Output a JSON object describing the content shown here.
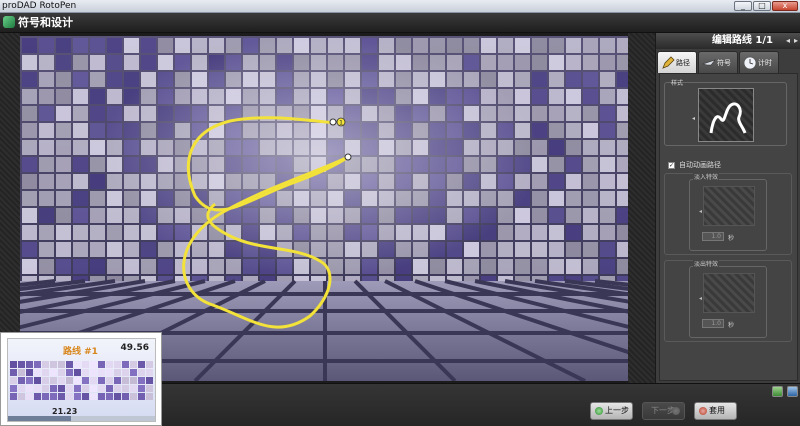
{
  "window": {
    "title": "proDAD RotoPen",
    "minimize": "_",
    "maximize": "□",
    "close": "x"
  },
  "header": {
    "title": "符号和设计"
  },
  "thumbnail": {
    "path_label": "路线 #1",
    "time_top": "49.56",
    "time_bottom": "21.23",
    "progress": 0.43
  },
  "panel": {
    "title": "编辑路线 1/1",
    "prev_arrow": "◂",
    "next_arrow": "▸",
    "tabs": [
      {
        "label": "路径",
        "icon": "pen-icon",
        "active": true
      },
      {
        "label": "符号",
        "icon": "plane-icon",
        "active": false
      },
      {
        "label": "计时",
        "icon": "clock-icon",
        "active": false
      }
    ],
    "style_label": "样式",
    "style_arrow": "◂",
    "auto_checkbox": {
      "label": "自动动画路径",
      "checked": true,
      "mark": "✓"
    },
    "fade_in": {
      "legend": "淡入特效",
      "value": "1.0",
      "unit": "秒",
      "arrow": "◂"
    },
    "fade_out": {
      "legend": "淡出特效",
      "value": "1.0",
      "unit": "秒",
      "arrow": "◂"
    }
  },
  "buttons": {
    "prev": "上一步",
    "next": "下一步",
    "apply": "套用"
  },
  "preview": {
    "path_color": "#f2e23a",
    "marker_number": "1"
  }
}
